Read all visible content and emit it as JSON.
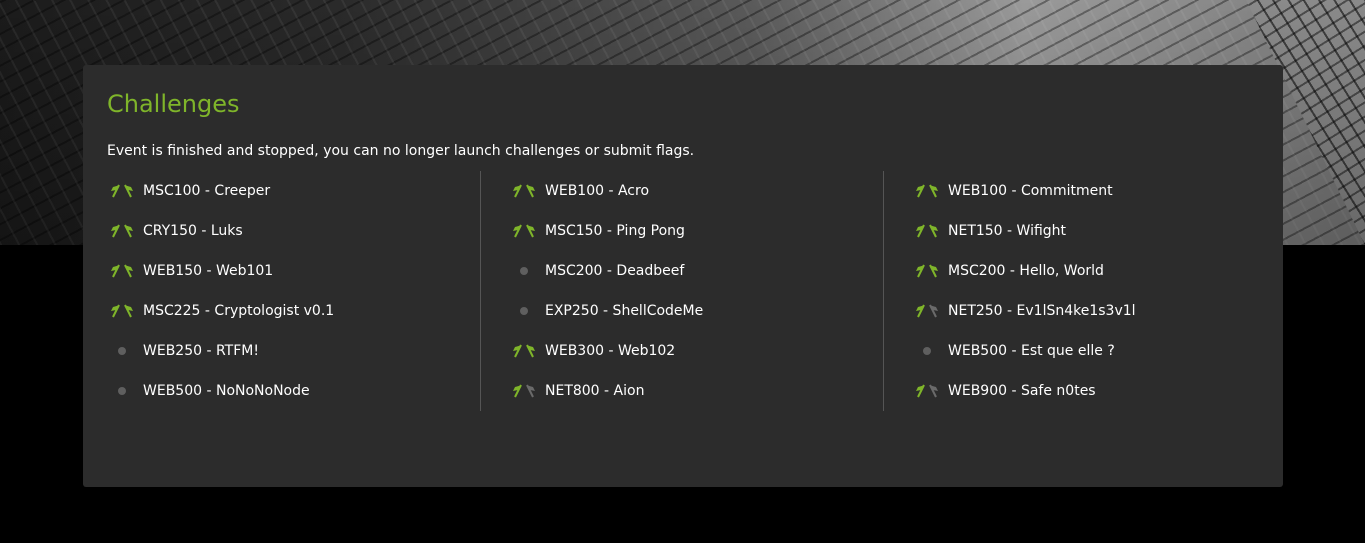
{
  "colors": {
    "accent": "#7fb52a",
    "flag_grey": "#6a6a6a",
    "dot_grey": "#5f5f5f",
    "panel_bg": "#2c2c2c"
  },
  "page": {
    "title": "Challenges",
    "notice": "Event is finished and stopped, you can no longer launch challenges or submit flags."
  },
  "columns": [
    [
      {
        "label": "MSC100 - Creeper",
        "status": "solved",
        "icon": "double-flag-icon"
      },
      {
        "label": "CRY150 - Luks",
        "status": "solved",
        "icon": "double-flag-icon"
      },
      {
        "label": "WEB150 - Web101",
        "status": "solved",
        "icon": "double-flag-icon"
      },
      {
        "label": "MSC225 - Cryptologist v0.1",
        "status": "solved",
        "icon": "double-flag-icon"
      },
      {
        "label": "WEB250 - RTFM!",
        "status": "unsolved",
        "icon": "dot-icon"
      },
      {
        "label": "WEB500 - NoNoNoNode",
        "status": "unsolved",
        "icon": "dot-icon"
      }
    ],
    [
      {
        "label": "WEB100 - Acro",
        "status": "solved",
        "icon": "double-flag-icon"
      },
      {
        "label": "MSC150 - Ping Pong",
        "status": "solved",
        "icon": "double-flag-icon"
      },
      {
        "label": "MSC200 - Deadbeef",
        "status": "unsolved",
        "icon": "dot-icon"
      },
      {
        "label": "EXP250 - ShellCodeMe",
        "status": "unsolved",
        "icon": "dot-icon"
      },
      {
        "label": "WEB300 - Web102",
        "status": "solved",
        "icon": "double-flag-icon"
      },
      {
        "label": "NET800 - Aion",
        "status": "partial",
        "icon": "half-flag-icon"
      }
    ],
    [
      {
        "label": "WEB100 - Commitment",
        "status": "solved",
        "icon": "double-flag-icon"
      },
      {
        "label": "NET150 - Wifight",
        "status": "solved",
        "icon": "double-flag-icon"
      },
      {
        "label": "MSC200 - Hello, World",
        "status": "solved",
        "icon": "double-flag-icon"
      },
      {
        "label": "NET250 - Ev1lSn4ke1s3v1l",
        "status": "partial",
        "icon": "half-flag-icon"
      },
      {
        "label": "WEB500 - Est que elle ?",
        "status": "unsolved",
        "icon": "dot-icon"
      },
      {
        "label": "WEB900 - Safe n0tes",
        "status": "partial",
        "icon": "half-flag-icon"
      }
    ]
  ]
}
